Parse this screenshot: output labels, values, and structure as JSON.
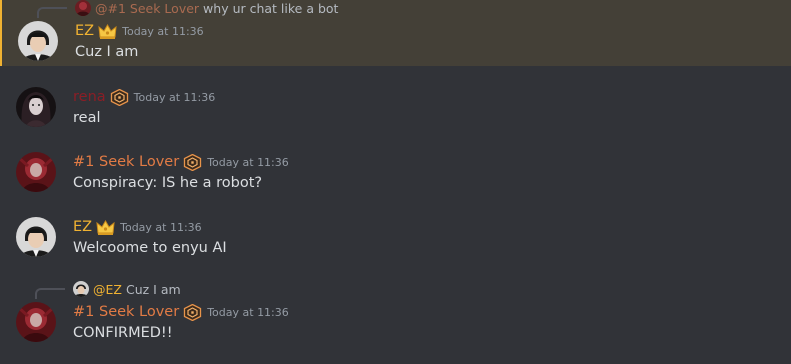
{
  "colors": {
    "background": "#313338",
    "highlight_bg": "#444037",
    "highlight_border": "#f0b232",
    "ez_name": "#f0b232",
    "seek_name": "#e27b45",
    "rena_name": "#8b1e26",
    "text": "#dbdee1",
    "muted": "#949ba4"
  },
  "messages": [
    {
      "reply": {
        "name": "@#1 Seek Lover",
        "text": "why ur chat like a bot"
      },
      "author": "EZ",
      "badge": "crown-icon",
      "timestamp": "Today at 11:36",
      "content": "Cuz I am",
      "highlighted": true
    },
    {
      "author": "rena",
      "badge": "hexagon-badge-icon",
      "timestamp": "Today at 11:36",
      "content": "real"
    },
    {
      "author": "#1 Seek Lover",
      "badge": "hexagon-badge-icon",
      "timestamp": "Today at 11:36",
      "content": "Conspiracy: IS he a robot?"
    },
    {
      "author": "EZ",
      "badge": "crown-icon",
      "timestamp": "Today at 11:36",
      "content": "Welcoome to enyu AI"
    },
    {
      "reply": {
        "name": "@EZ",
        "text": "Cuz I am"
      },
      "author": "#1 Seek Lover",
      "badge": "hexagon-badge-icon",
      "timestamp": "Today at 11:36",
      "content": "CONFIRMED!!"
    }
  ]
}
